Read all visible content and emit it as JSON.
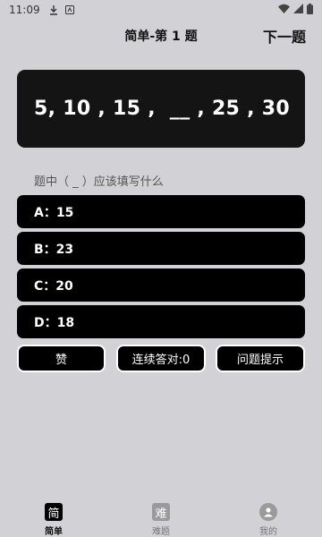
{
  "status_bar": {
    "time": "11:09",
    "icons": [
      "download-icon",
      "notification-app-icon",
      "wifi-icon",
      "signal-icon",
      "battery-icon"
    ]
  },
  "header": {
    "title": "简单-第 1 题",
    "next_label": "下一题"
  },
  "question": {
    "sequence": "5, 10 , 15 ,  __ , 25 , 30"
  },
  "prompt": "题中（ _ ）应该填写什么",
  "options": [
    {
      "label": "A：15"
    },
    {
      "label": "B：23"
    },
    {
      "label": "C：20"
    },
    {
      "label": "D：18"
    }
  ],
  "actions": {
    "like_label": "赞",
    "streak_label": "连续答对:0",
    "hint_label": "问题提示"
  },
  "bottom_nav": {
    "items": [
      {
        "icon_text": "简",
        "label": "简单",
        "active": true
      },
      {
        "icon_text": "难",
        "label": "难题",
        "active": false
      },
      {
        "icon_text": "",
        "label": "我的",
        "active": false
      }
    ]
  },
  "colors": {
    "background": "#d2d1d6",
    "card": "#141414",
    "option": "#000000",
    "text_light": "#ffffff"
  }
}
